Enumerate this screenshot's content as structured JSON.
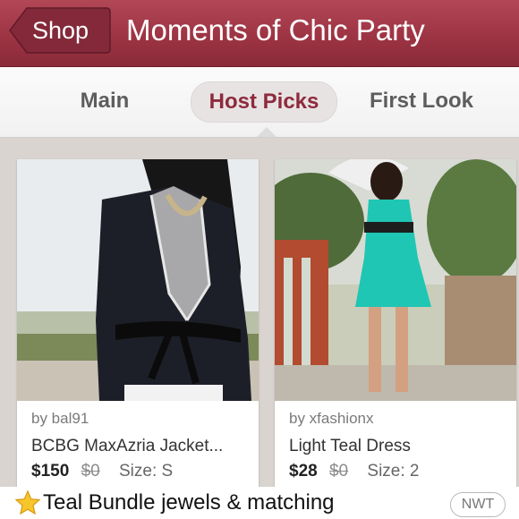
{
  "header": {
    "back_label": "Shop",
    "title": "Moments of Chic Party"
  },
  "tabs": [
    {
      "label": "Main",
      "active": false
    },
    {
      "label": "Host Picks",
      "active": true
    },
    {
      "label": "First Look",
      "active": false
    }
  ],
  "listings": [
    {
      "user": "by bal91",
      "title": "BCBG MaxAzria Jacket...",
      "price": "$150",
      "original_price": "$0",
      "size": "Size: S"
    },
    {
      "user": "by xfashionx",
      "title": "Light Teal Dress",
      "price": "$28",
      "original_price": "$0",
      "size": "Size: 2"
    }
  ],
  "caption": {
    "icon": "star-icon",
    "text": "Teal Bundle jewels & matching",
    "badge": "NWT"
  },
  "colors": {
    "header": "#9d3444",
    "active_tab_text": "#8e2a3c",
    "background": "#d9d4cf",
    "dress_teal": "#1fc6b3"
  }
}
